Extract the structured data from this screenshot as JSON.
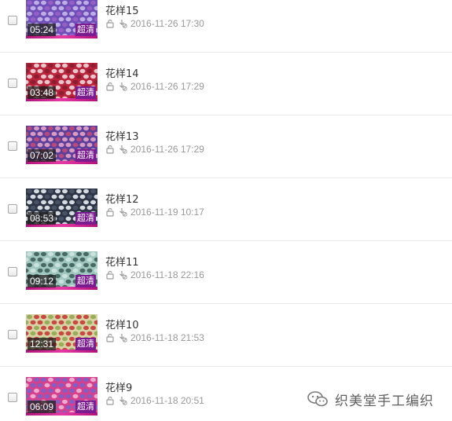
{
  "badge_label": "超清",
  "videos": [
    {
      "title": "花样15",
      "duration": "05:24",
      "date": "2016-11-26 17:30",
      "colors": [
        "#6e4fb8",
        "#c8b7ea",
        "#9b5fc8"
      ]
    },
    {
      "title": "花样14",
      "duration": "03:48",
      "date": "2016-11-26 17:29",
      "colors": [
        "#b8243c",
        "#f0d7da",
        "#8c1d2e"
      ]
    },
    {
      "title": "花样13",
      "duration": "07:02",
      "date": "2016-11-26 17:29",
      "colors": [
        "#5b3f9a",
        "#e4a5c8",
        "#c04a7a"
      ]
    },
    {
      "title": "花样12",
      "duration": "08:53",
      "date": "2016-11-19 10:17",
      "colors": [
        "#2c3446",
        "#e9edf2",
        "#4b5568"
      ]
    },
    {
      "title": "花样11",
      "duration": "09:12",
      "date": "2016-11-18 22:16",
      "colors": [
        "#9fc7c0",
        "#3f5f5a",
        "#cfe3de"
      ]
    },
    {
      "title": "花样10",
      "duration": "12:31",
      "date": "2016-11-18 21:53",
      "colors": [
        "#d9d4a8",
        "#c43b36",
        "#8faa4f"
      ]
    },
    {
      "title": "花样9",
      "duration": "06:09",
      "date": "2016-11-18 20:51",
      "colors": [
        "#d6408c",
        "#7b62c9",
        "#f0b8d6"
      ]
    }
  ],
  "watermark": {
    "text": "织美堂手工编织",
    "icon": "wechat-icon"
  }
}
